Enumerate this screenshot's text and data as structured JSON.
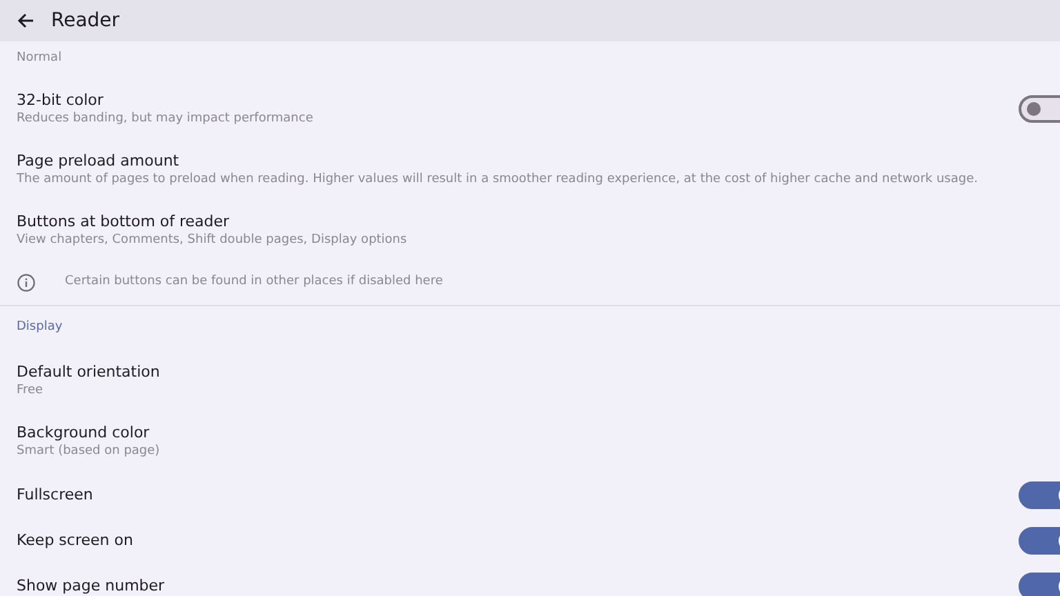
{
  "app_bar": {
    "title": "Reader"
  },
  "items": [
    {
      "kind": "value",
      "subtitle": "Normal"
    },
    {
      "kind": "switch",
      "title": "32-bit color",
      "subtitle": "Reduces banding, but may impact performance",
      "on": false
    },
    {
      "kind": "text",
      "title": "Page preload amount",
      "subtitle": "The amount of pages to preload when reading. Higher values will result in a smoother reading experience, at the cost of higher cache and network usage."
    },
    {
      "kind": "text",
      "title": "Buttons at bottom of reader",
      "subtitle": "View chapters, Comments, Shift double pages, Display options"
    },
    {
      "kind": "info",
      "text": "Certain buttons can be found in other places if disabled here"
    },
    {
      "kind": "header",
      "text": "Display"
    },
    {
      "kind": "text",
      "title": "Default orientation",
      "subtitle": "Free"
    },
    {
      "kind": "text",
      "title": "Background color",
      "subtitle": "Smart (based on page)"
    },
    {
      "kind": "switch",
      "title": "Fullscreen",
      "on": true
    },
    {
      "kind": "switch",
      "title": "Keep screen on",
      "on": true
    },
    {
      "kind": "switch",
      "title": "Show page number",
      "on": true
    }
  ]
}
